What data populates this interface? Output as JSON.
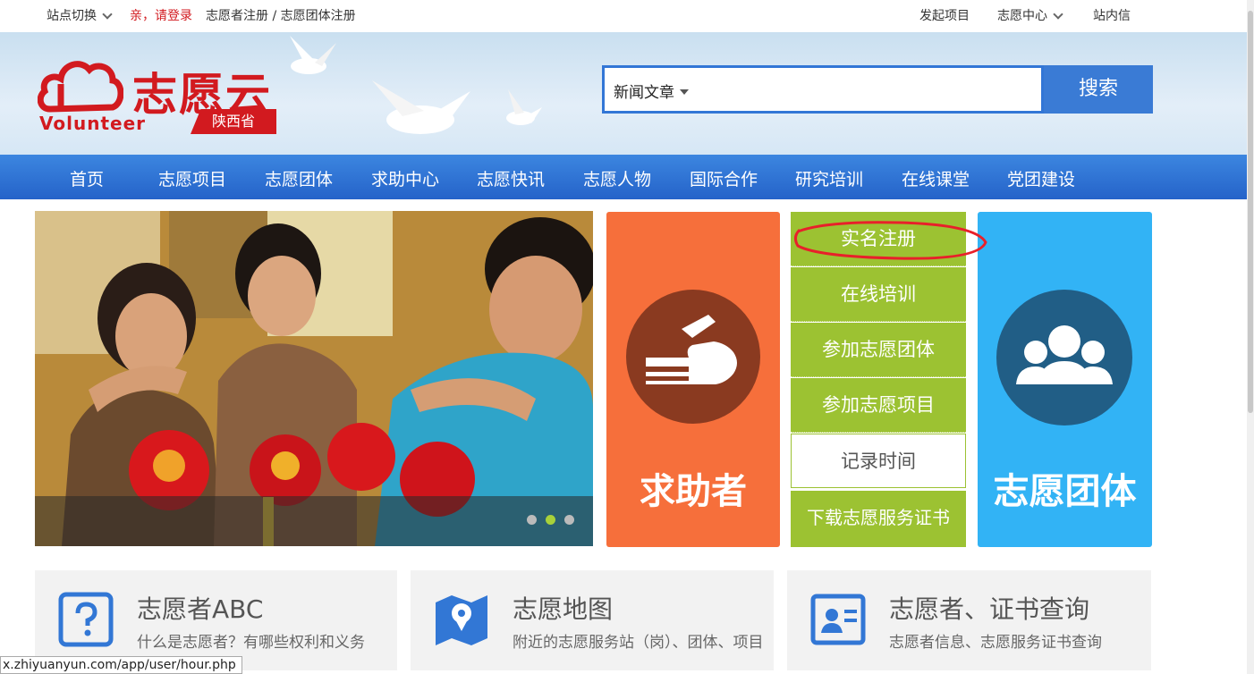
{
  "topbar": {
    "site_switch": "站点切换",
    "login": "亲，请登录",
    "register": "志愿者注册 / 志愿团体注册",
    "start_project": "发起项目",
    "volunteer_center": "志愿中心",
    "inbox": "站内信"
  },
  "header": {
    "logo_text": "志愿云",
    "logo_en": "Volunteer",
    "province": "陕西省",
    "search_category": "新闻文章",
    "search_button": "搜索"
  },
  "nav": [
    "首页",
    "志愿项目",
    "志愿团体",
    "求助中心",
    "志愿快讯",
    "志愿人物",
    "国际合作",
    "研究培训",
    "在线课堂",
    "党团建设"
  ],
  "tiles": {
    "help_seeker": "求助者",
    "volunteer_group": "志愿团体",
    "actions": [
      "实名注册",
      "在线培训",
      "参加志愿团体",
      "参加志愿项目",
      "记录时间",
      "下载志愿服务证书"
    ]
  },
  "cards": [
    {
      "title": "志愿者ABC",
      "subtitle": "什么是志愿者？有哪些权利和义务"
    },
    {
      "title": "志愿地图",
      "subtitle": "附近的志愿服务站（岗）、团体、项目"
    },
    {
      "title": "志愿者、证书查询",
      "subtitle": "志愿者信息、志愿服务证书查询"
    }
  ],
  "status_url": "x.zhiyuanyun.com/app/user/hour.php",
  "colors": {
    "brand_red": "#d21a1f",
    "nav_blue": "#2c6fd4",
    "orange": "#f66f3b",
    "green": "#9cc232",
    "sky_blue": "#32b3f5"
  }
}
